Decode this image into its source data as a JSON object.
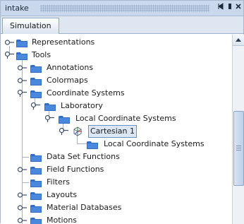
{
  "window": {
    "title": "intake",
    "controls": {
      "pin": "pin",
      "minimize": "minimize",
      "close": "close"
    }
  },
  "tabs": [
    {
      "label": "Simulation",
      "active": true
    }
  ],
  "tree": {
    "items": [
      {
        "label": "Representations",
        "expanded": false,
        "level": 0,
        "icon": "folder-icon"
      },
      {
        "label": "Tools",
        "expanded": true,
        "level": 0,
        "icon": "folder-icon"
      },
      {
        "label": "Annotations",
        "expanded": false,
        "level": 1,
        "icon": "folder-icon"
      },
      {
        "label": "Colormaps",
        "expanded": false,
        "level": 1,
        "icon": "folder-icon"
      },
      {
        "label": "Coordinate Systems",
        "expanded": true,
        "level": 1,
        "icon": "folder-icon"
      },
      {
        "label": "Laboratory",
        "expanded": true,
        "level": 2,
        "icon": "folder-icon"
      },
      {
        "label": "Local Coordinate Systems",
        "expanded": true,
        "level": 3,
        "icon": "folder-icon"
      },
      {
        "label": "Cartesian 1",
        "expanded": true,
        "level": 4,
        "icon": "coordinate-system-cube-icon",
        "selected": true
      },
      {
        "label": "Local Coordinate Systems",
        "expanded": false,
        "level": 5,
        "icon": "folder-icon",
        "leaf": true
      },
      {
        "label": "Data Set Functions",
        "expanded": false,
        "level": 1,
        "icon": "folder-icon",
        "leaf": true
      },
      {
        "label": "Field Functions",
        "expanded": false,
        "level": 1,
        "icon": "folder-icon"
      },
      {
        "label": "Filters",
        "expanded": false,
        "level": 1,
        "icon": "folder-icon",
        "leaf": true
      },
      {
        "label": "Layouts",
        "expanded": false,
        "level": 1,
        "icon": "folder-icon"
      },
      {
        "label": "Material Databases",
        "expanded": false,
        "level": 1,
        "icon": "folder-icon"
      },
      {
        "label": "Motions",
        "expanded": false,
        "level": 1,
        "icon": "folder-icon"
      }
    ]
  },
  "colors": {
    "folder": "#2f6fc9",
    "selection_border": "#6f8fbf",
    "title_bar": "#c9d8ec"
  }
}
